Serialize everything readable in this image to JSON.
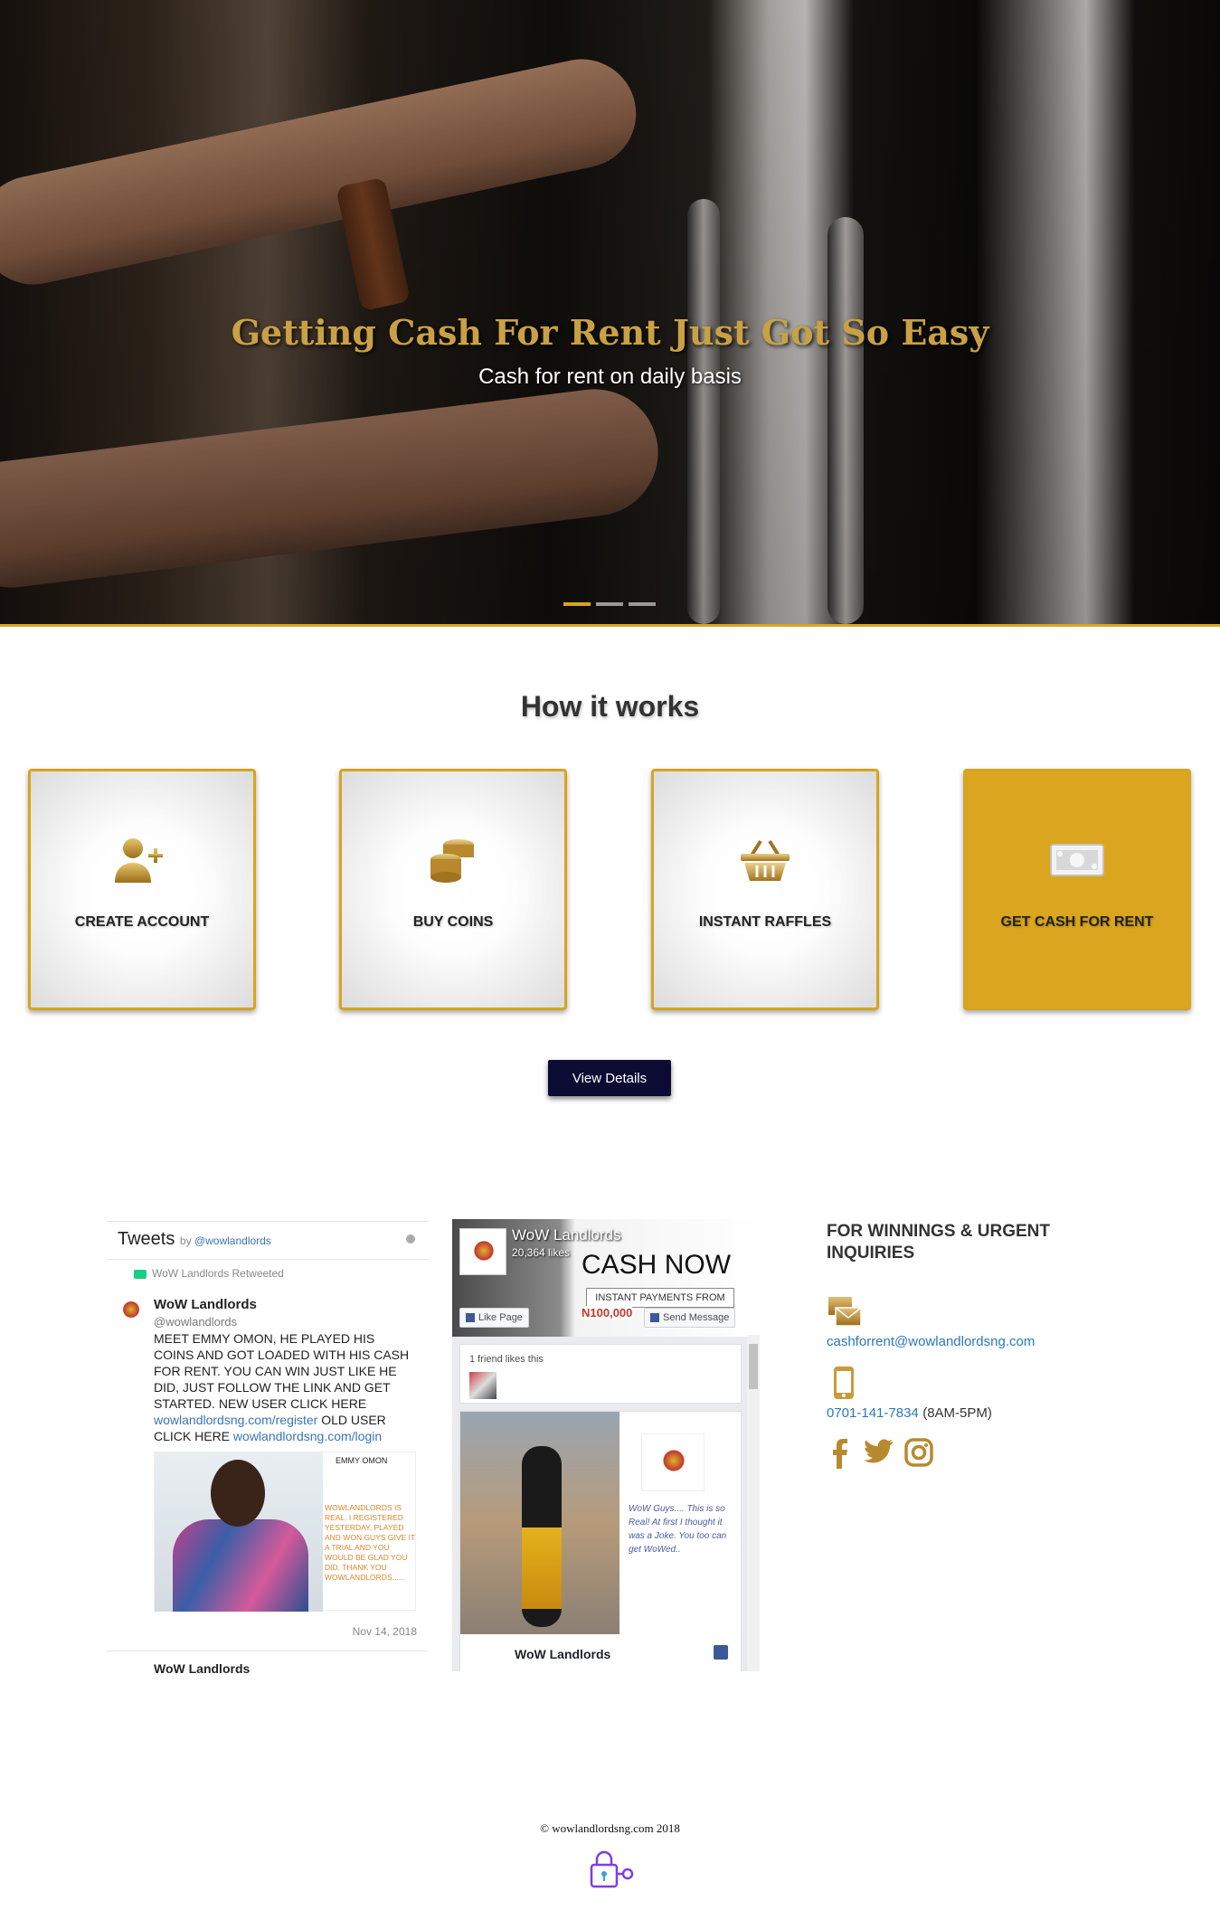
{
  "hero": {
    "title": "Getting Cash For Rent Just Got So Easy",
    "subtitle": "Cash for rent on daily basis",
    "slides": [
      true,
      false,
      false
    ]
  },
  "how": {
    "heading": "How it works",
    "steps": [
      {
        "label": "CREATE ACCOUNT",
        "icon": "add-user-icon"
      },
      {
        "label": "BUY COINS",
        "icon": "coins-icon"
      },
      {
        "label": "INSTANT RAFFLES",
        "icon": "basket-icon"
      },
      {
        "label": "GET CASH FOR RENT",
        "icon": "cash-icon"
      }
    ],
    "button": "View Details",
    "accent": "#d6a51f",
    "button_color": "#0b0b33"
  },
  "tweets": {
    "title": "Tweets",
    "by": "by",
    "handle": "@wowlandlords",
    "retweeted": "WoW Landlords Retweeted",
    "author": "WoW Landlords",
    "author_handle": "@wowlandlords",
    "text": "MEET EMMY OMON, HE PLAYED HIS COINS AND GOT LOADED WITH HIS CASH FOR RENT. YOU CAN WIN JUST LIKE HE DID, JUST FOLLOW THE LINK AND GET STARTED. NEW USER CLICK HERE",
    "link1": "wowlandlordsng.com/register",
    "mid": "OLD USER CLICK HERE",
    "link2": "wowlandlordsng.com/login",
    "image_name": "EMMY OMON",
    "image_text": "WOWLANDLORDS IS REAL. I REGISTERED YESTERDAY, PLAYED AND WON.GUYS GIVE IT A TRIAL AND YOU WOULD BE GLAD YOU DID. THANK YOU WOWLANDLORDS......",
    "date": "Nov 14, 2018",
    "next_author": "WoW Landlords"
  },
  "facebook": {
    "page_name": "WoW Landlords",
    "likes": "20,364 likes",
    "cover_cash": "CASH",
    "cover_now": "NOW",
    "cover_payments": "INSTANT PAYMENTS FROM",
    "cover_amount": "N100,000",
    "like_page": "Like Page",
    "send_message": "Send Message",
    "friend_likes": "1 friend likes this",
    "post_caption": "WoW Guys.... This is so Real! At first I thought it was a Joke. You too can get WoWed..",
    "post_author": "WoW Landlords"
  },
  "contact": {
    "heading": "FOR WINNINGS & URGENT INQUIRIES",
    "email": "cashforrent@wowlandlordsng.com",
    "phone": "0701-141-7834",
    "hours": "(8AM-5PM)",
    "icons": [
      "mail-icon",
      "phone-icon",
      "facebook-icon",
      "twitter-icon",
      "instagram-icon"
    ]
  },
  "footer": {
    "copyright": "© wowlandlordsng.com 2018"
  }
}
